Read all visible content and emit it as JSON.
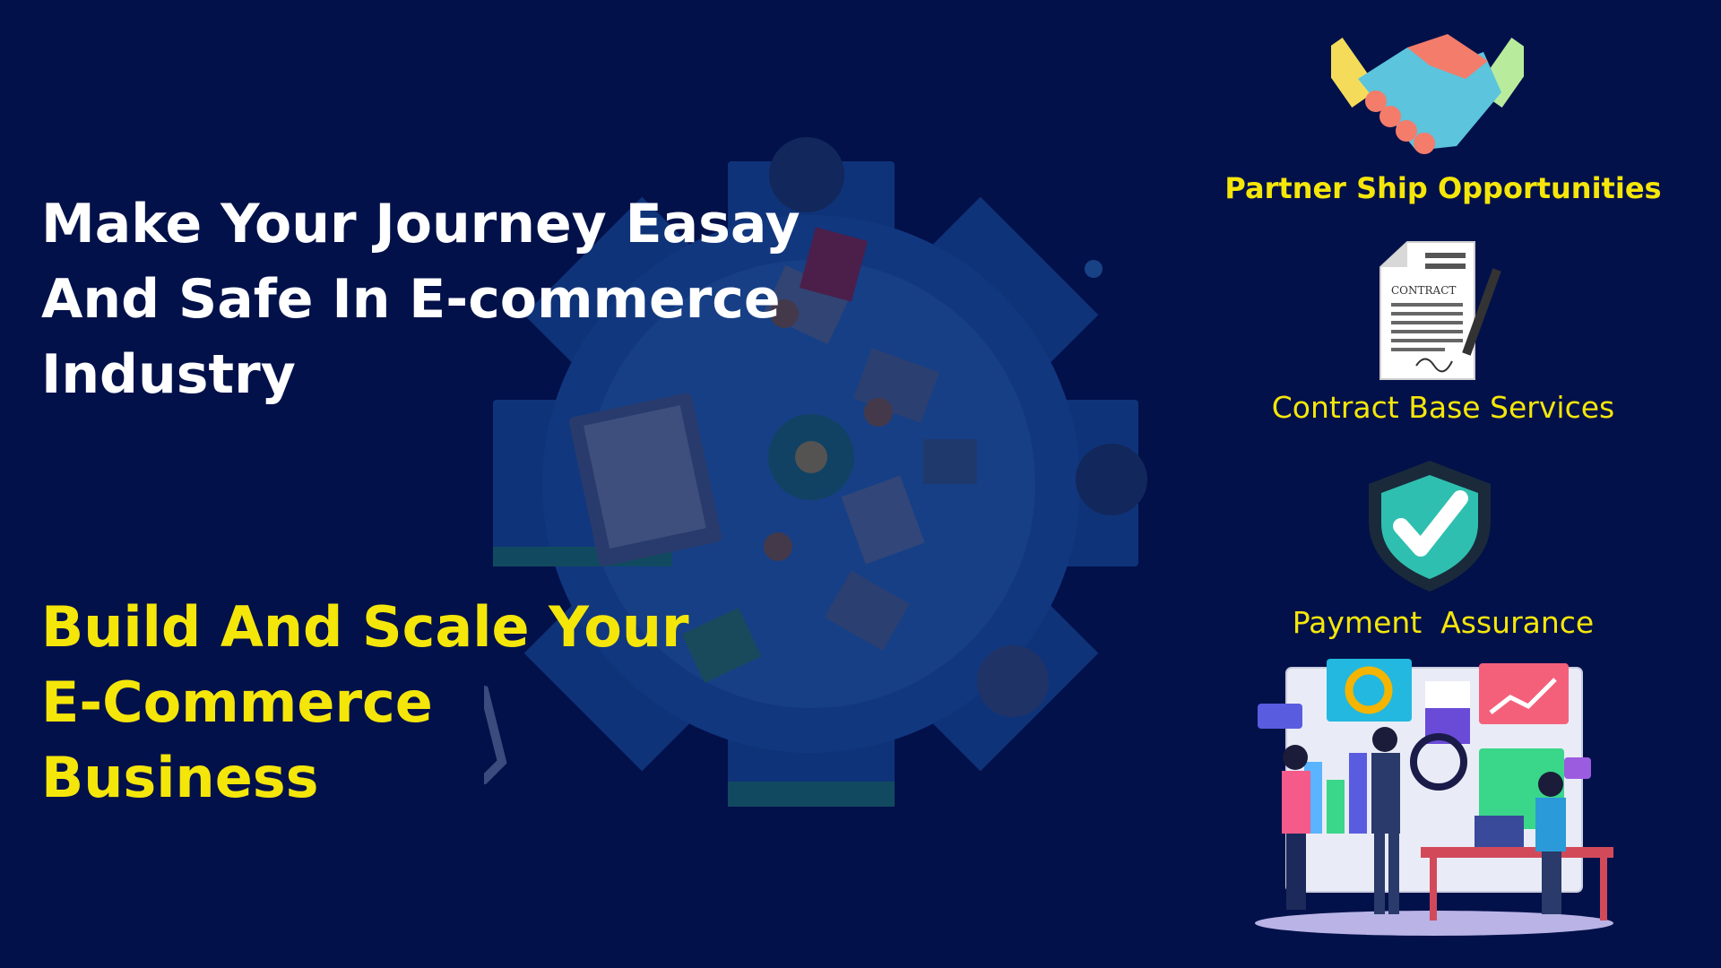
{
  "headline": "Make Your Journey Easay\nAnd  Safe In E-commerce\nIndustry",
  "subheadline": "Build And Scale Your\nE-Commerce\nBusiness",
  "features": [
    {
      "label": "Partner Ship Opportunities",
      "icon": "handshake-icon"
    },
    {
      "label": "Contract Base Services",
      "icon": "contract-icon"
    },
    {
      "label": "Payment  Assurance",
      "icon": "shield-check-icon"
    }
  ],
  "contract_icon_text": "CONTRACT",
  "colors": {
    "background": "#02114a",
    "headline": "#ffffff",
    "accent_yellow": "#f5e60a",
    "illustration_blue": "#1a4a9c"
  }
}
